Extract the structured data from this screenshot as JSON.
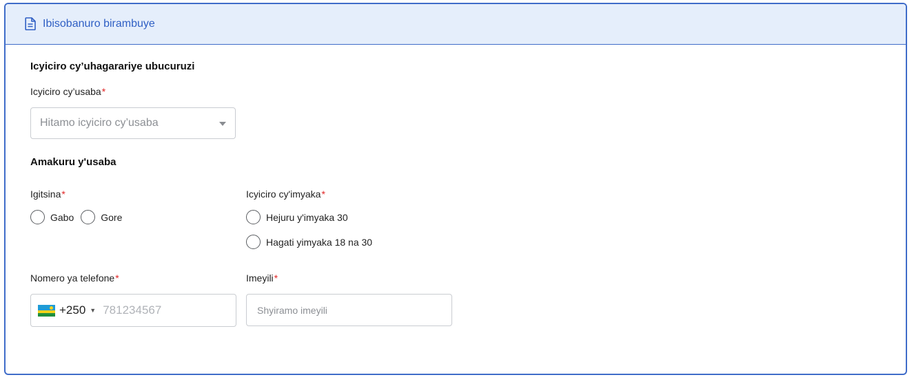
{
  "header": {
    "title": "Ibisobanuro birambuye",
    "icon": "document-icon"
  },
  "section_representative": {
    "title": "Icyiciro cy’uhagarariye ubucuruzi",
    "category_label": "Icyiciro cy’usaba",
    "required_mark": "*",
    "category_placeholder": "Hitamo icyiciro cy’usaba"
  },
  "section_applicant": {
    "title": "Amakuru y'usaba",
    "gender": {
      "label": "Igitsina",
      "options": [
        "Gabo",
        "Gore"
      ]
    },
    "age": {
      "label": "Icyiciro cy'imyaka",
      "options": [
        "Hejuru y'imyaka 30",
        "Hagati yimyaka 18 na 30"
      ]
    },
    "phone": {
      "label": "Nomero ya telefone",
      "country_code": "+250",
      "placeholder": "781234567"
    },
    "email": {
      "label": "Imeyili",
      "placeholder": "Shyiramo imeyili"
    }
  },
  "colors": {
    "accent": "#3f6cc9",
    "header_bg": "#e5eefb",
    "required": "#e02424"
  }
}
